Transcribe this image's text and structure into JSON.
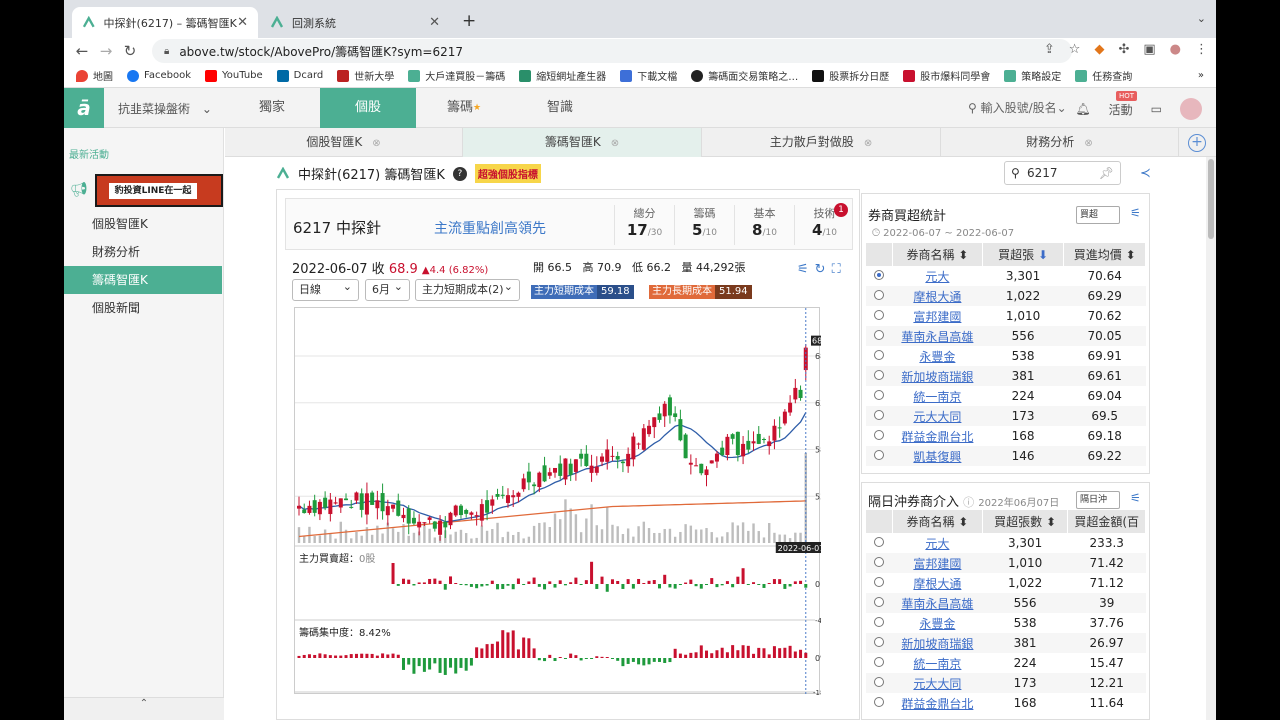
{
  "browser": {
    "tabs": [
      {
        "title": "中探針(6217) – 籌碼智匯K｜豹投",
        "active": true
      },
      {
        "title": "回測系統",
        "active": false
      }
    ],
    "url": "above.tw/stock/AbovePro/籌碼智匯K?sym=6217",
    "bookmarks": [
      "地圖",
      "Facebook",
      "YouTube",
      "Dcard",
      "世新大學",
      "大戶達買股－籌碼",
      "縮短網址產生器",
      "下載文檔",
      "籌碼面交易策略之…",
      "股票拆分日歷",
      "股市爆料同學會",
      "策略設定",
      "任務查詢"
    ],
    "more": "»"
  },
  "site": {
    "user_menu": "抗韭菜操盤術",
    "nav": [
      "獨家",
      "個股",
      "籌碼",
      "智識"
    ],
    "active_nav": "個股",
    "search_placeholder": "輸入股號/股名",
    "activity": "活動",
    "hot": "HOT"
  },
  "sidebar": {
    "recent": "最新活動",
    "banner": "豹投資LINE在一起",
    "items": [
      "個股智匯K",
      "財務分析",
      "籌碼智匯K",
      "個股新聞"
    ],
    "active": "籌碼智匯K"
  },
  "subtabs": [
    "個股智匯K",
    "籌碼智匯K",
    "主力散戶對做股",
    "財務分析"
  ],
  "page": {
    "title": "中探針(6217) 籌碼智匯K",
    "tag": "超強個股指標",
    "search_value": "6217"
  },
  "card": {
    "name": "6217 中探針",
    "slogan": "主流重點創高領先",
    "scores": [
      {
        "label": "總分",
        "value": "17",
        "denom": "/30"
      },
      {
        "label": "籌碼",
        "value": "5",
        "denom": "/10"
      },
      {
        "label": "基本",
        "value": "8",
        "denom": "/10"
      },
      {
        "label": "技術",
        "value": "4",
        "denom": "/10"
      }
    ],
    "badge": "1"
  },
  "quote": {
    "date_close": "2022-06-07 收",
    "price": "68.9",
    "change": "▲4.4 (6.82%)",
    "open": "開 66.5",
    "high": "高 70.9",
    "low": "低 66.2",
    "volume": "量 44,292張"
  },
  "controls": {
    "period": "日線",
    "range": "6月",
    "indicator": "主力短期成本(2)",
    "short_cost_label": "主力短期成本",
    "short_cost": "59.18",
    "long_cost_label": "主力長期成本",
    "long_cost": "51.94"
  },
  "chart_data": {
    "type": "candlestick",
    "price_ticks": [
      "68",
      "63",
      "58",
      "53"
    ],
    "last_price_tag": "68.9",
    "date_tag": "2022-06-07",
    "sub1_title": "主力買賣超：",
    "sub1_value": "0股",
    "sub1_ticks": [
      "0",
      "-4千張"
    ],
    "sub2_title": "籌碼集中度：8.42%",
    "sub2_ticks": [
      "0%",
      "-18.4%"
    ],
    "colors": {
      "up": "#c8102e",
      "down": "#1e9a3c",
      "ma_short": "#2e5da8",
      "ma_long": "#e06a3a",
      "volume": "#bdbdbd"
    }
  },
  "panel1": {
    "title": "券商買超統計",
    "select": "買超",
    "date": "2022-06-07 ~ 2022-06-07",
    "headers": [
      "券商名稱",
      "買超張",
      "買進均價"
    ],
    "rows": [
      [
        "元大",
        "3,301",
        "70.64"
      ],
      [
        "摩根大通",
        "1,022",
        "69.29"
      ],
      [
        "富邦建國",
        "1,010",
        "70.62"
      ],
      [
        "華南永昌高雄",
        "556",
        "70.05"
      ],
      [
        "永豐金",
        "538",
        "69.91"
      ],
      [
        "新加坡商瑞銀",
        "381",
        "69.61"
      ],
      [
        "統一南京",
        "224",
        "69.04"
      ],
      [
        "元大大同",
        "173",
        "69.5"
      ],
      [
        "群益金鼎台北",
        "168",
        "69.18"
      ],
      [
        "凱基復興",
        "146",
        "69.22"
      ]
    ]
  },
  "panel2": {
    "title": "隔日沖券商介入",
    "date": "2022年06月07日",
    "select": "隔日沖",
    "headers": [
      "券商名稱",
      "買超張數",
      "買超金額(百"
    ],
    "rows": [
      [
        "元大",
        "3,301",
        "233.3"
      ],
      [
        "富邦建國",
        "1,010",
        "71.42"
      ],
      [
        "摩根大通",
        "1,022",
        "71.12"
      ],
      [
        "華南永昌高雄",
        "556",
        "39"
      ],
      [
        "永豐金",
        "538",
        "37.76"
      ],
      [
        "新加坡商瑞銀",
        "381",
        "26.97"
      ],
      [
        "統一南京",
        "224",
        "15.47"
      ],
      [
        "元大大同",
        "173",
        "12.21"
      ],
      [
        "群益金鼎台北",
        "168",
        "11.64"
      ]
    ]
  }
}
